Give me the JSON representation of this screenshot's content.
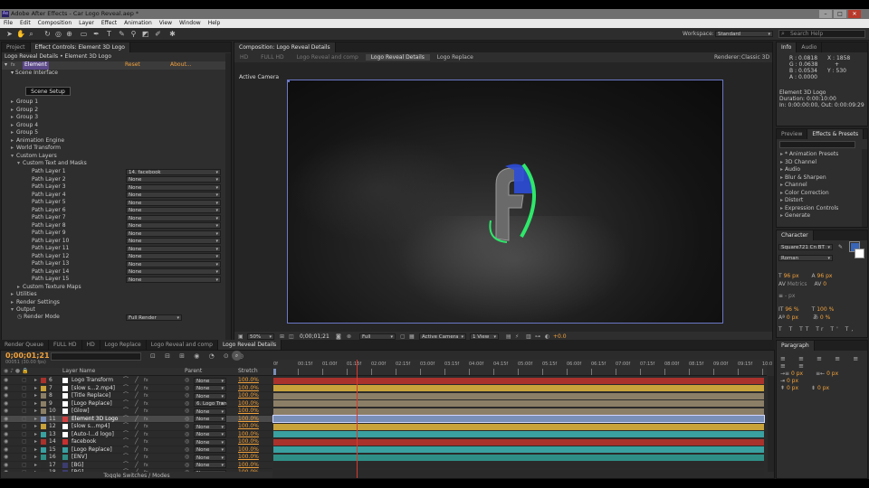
{
  "app": {
    "title": "Adobe After Effects - Car Logo Reveal.aep *",
    "icon_text": "Ae",
    "window_controls": [
      "minimize-icon",
      "maximize-icon",
      "close-icon"
    ],
    "menu": [
      "File",
      "Edit",
      "Composition",
      "Layer",
      "Effect",
      "Animation",
      "View",
      "Window",
      "Help"
    ]
  },
  "toolbar": {
    "workspace_label": "Workspace:",
    "workspace_value": "Standard",
    "search_placeholder": "Search Help"
  },
  "effect_panel": {
    "tabs": [
      "Project",
      "Effect Controls: Element 3D Logo"
    ],
    "header": "Logo Reveal Details • Element 3D Logo",
    "effect_name": "Element",
    "reset": "Reset",
    "about": "About...",
    "scene_interface": "Scene Interface",
    "scene_setup": "Scene Setup",
    "groups": [
      "Group 1",
      "Group 2",
      "Group 3",
      "Group 4",
      "Group 5"
    ],
    "sections": [
      "Animation Engine",
      "World Transform",
      "Custom Layers"
    ],
    "custom_text": "Custom Text and Masks",
    "path_layers": [
      {
        "label": "Path Layer 1",
        "value": "14. facebook"
      },
      {
        "label": "Path Layer 2",
        "value": "None"
      },
      {
        "label": "Path Layer 3",
        "value": "None"
      },
      {
        "label": "Path Layer 4",
        "value": "None"
      },
      {
        "label": "Path Layer 5",
        "value": "None"
      },
      {
        "label": "Path Layer 6",
        "value": "None"
      },
      {
        "label": "Path Layer 7",
        "value": "None"
      },
      {
        "label": "Path Layer 8",
        "value": "None"
      },
      {
        "label": "Path Layer 9",
        "value": "None"
      },
      {
        "label": "Path Layer 10",
        "value": "None"
      },
      {
        "label": "Path Layer 11",
        "value": "None"
      },
      {
        "label": "Path Layer 12",
        "value": "None"
      },
      {
        "label": "Path Layer 13",
        "value": "None"
      },
      {
        "label": "Path Layer 14",
        "value": "None"
      },
      {
        "label": "Path Layer 15",
        "value": "None"
      }
    ],
    "after": [
      "Custom Texture Maps",
      "Utilities",
      "Render Settings",
      "Output"
    ],
    "render_mode_label": "Render Mode",
    "render_mode_value": "Full Render"
  },
  "comp_panel": {
    "tab": "Composition: Logo Reveal Details",
    "breadcrumbs": [
      "HD",
      "FULL HD",
      "Logo Reveal and comp",
      "Logo Reveal Details",
      "Logo Replace"
    ],
    "renderer_label": "Renderer:",
    "renderer_value": "Classic 3D",
    "camera_label": "Active Camera",
    "zoom": "50%",
    "timecode": "0;00;01;21",
    "resolution": "Full",
    "view_camera": "Active Camera",
    "views": "1 View",
    "exposure": "+0.0"
  },
  "info_panel": {
    "tabs": [
      "Info",
      "Audio"
    ],
    "rgba": [
      {
        "k": "R",
        "v": "0.0818"
      },
      {
        "k": "G",
        "v": "0.0638"
      },
      {
        "k": "B",
        "v": "0.0534"
      },
      {
        "k": "A",
        "v": "0.0000"
      }
    ],
    "xy": [
      {
        "k": "X",
        "v": "1858"
      },
      {
        "k": "Y",
        "v": "530"
      }
    ],
    "layer_name": "Element 3D Logo",
    "duration": "Duration: 0:00:10:00",
    "in_out": "In: 0:00:00:00, Out: 0:00:09:29"
  },
  "effects_presets": {
    "tabs": [
      "Preview",
      "Effects & Presets"
    ],
    "items": [
      "* Animation Presets",
      "3D Channel",
      "Audio",
      "Blur & Sharpen",
      "Channel",
      "Color Correction",
      "Distort",
      "Expression Controls",
      "Generate"
    ]
  },
  "character": {
    "tab": "Character",
    "font": "Square721 Cn BT",
    "style": "Roman",
    "size": "96 px",
    "leading": "96 px",
    "kerning": "Metrics",
    "tracking": "0",
    "stroke": "- px",
    "vscale": "96 %",
    "hscale": "100 %",
    "baseline": "0 px",
    "tsume": "0 %",
    "fill_color": "#3a66b8"
  },
  "paragraph": {
    "tab": "Paragraph",
    "indent": [
      "0 px",
      "0 px",
      "0 px",
      "0 px",
      "0 px"
    ]
  },
  "bottom_tabs": [
    "Render Queue",
    "FULL HD",
    "HD",
    "Logo Replace",
    "Logo Reveal and comp",
    "Logo Reveal Details"
  ],
  "timeline": {
    "timecode": "0;00;01;21",
    "subtime": "00051 (30.00 fps)",
    "search_placeholder": "",
    "col_layer": "Layer Name",
    "col_parent": "Parent",
    "col_stretch": "Stretch",
    "ruler": [
      "0f",
      "00:15f",
      "01:00f",
      "01:15f",
      "02:00f",
      "02:15f",
      "03:00f",
      "03:15f",
      "04:00f",
      "04:15f",
      "05:00f",
      "05:15f",
      "06:00f",
      "06:15f",
      "07:00f",
      "07:15f",
      "08:00f",
      "08:15f",
      "09:00f",
      "09:15f",
      "10:0"
    ],
    "toggle": "Toggle Switches / Modes",
    "layers": [
      {
        "num": "6",
        "name": "Logo Transform",
        "parent": "None",
        "stretch": "100.0%",
        "color": "#a9322c",
        "swatch": "#ffffff"
      },
      {
        "num": "7",
        "name": "[slow s...2.mp4]",
        "parent": "None",
        "stretch": "100.0%",
        "color": "#c8a23a",
        "swatch": "#ffffff"
      },
      {
        "num": "8",
        "name": "[Title Replace]",
        "parent": "None",
        "stretch": "100.0%",
        "color": "#8c7f67",
        "swatch": "#ffffff"
      },
      {
        "num": "9",
        "name": "[Logo Replace]",
        "parent": "6. Logo Tran",
        "stretch": "100.0%",
        "color": "#8c7f67",
        "swatch": "#ffffff"
      },
      {
        "num": "10",
        "name": "[Glow]",
        "parent": "None",
        "stretch": "100.0%",
        "color": "#8c7f67",
        "swatch": "#ffffff"
      },
      {
        "num": "11",
        "name": "Element 3D Logo",
        "parent": "None",
        "stretch": "100.0%",
        "color": "#7a8fb8",
        "swatch": "#d04040",
        "selected": true
      },
      {
        "num": "12",
        "name": "[slow s...mp4]",
        "parent": "None",
        "stretch": "100.0%",
        "color": "#c8a23a",
        "swatch": "#ffffff"
      },
      {
        "num": "13",
        "name": "[Auto-l...d logo]",
        "parent": "None",
        "stretch": "100.0%",
        "color": "#3aa0a0",
        "swatch": "#ffffff"
      },
      {
        "num": "14",
        "name": "facebook",
        "parent": "None",
        "stretch": "100.0%",
        "color": "#a9322c",
        "swatch": "#c83030"
      },
      {
        "num": "15",
        "name": "[Logo Replace]",
        "parent": "None",
        "stretch": "100.0%",
        "color": "#3aa0a0",
        "swatch": "#3aa0a0"
      },
      {
        "num": "16",
        "name": "[ENV]",
        "parent": "None",
        "stretch": "100.0%",
        "color": "#2f8f86",
        "swatch": "#2f8f86"
      },
      {
        "num": "17",
        "name": "[BG]",
        "parent": "None",
        "stretch": "100.0%",
        "color": "#2a2a2a",
        "swatch": "#3c3c6e"
      },
      {
        "num": "18",
        "name": "[BG]",
        "parent": "None",
        "stretch": "100.0%",
        "color": "#2a2a2a",
        "swatch": "#3c3c6e"
      }
    ],
    "playhead_fraction": 0.17
  }
}
